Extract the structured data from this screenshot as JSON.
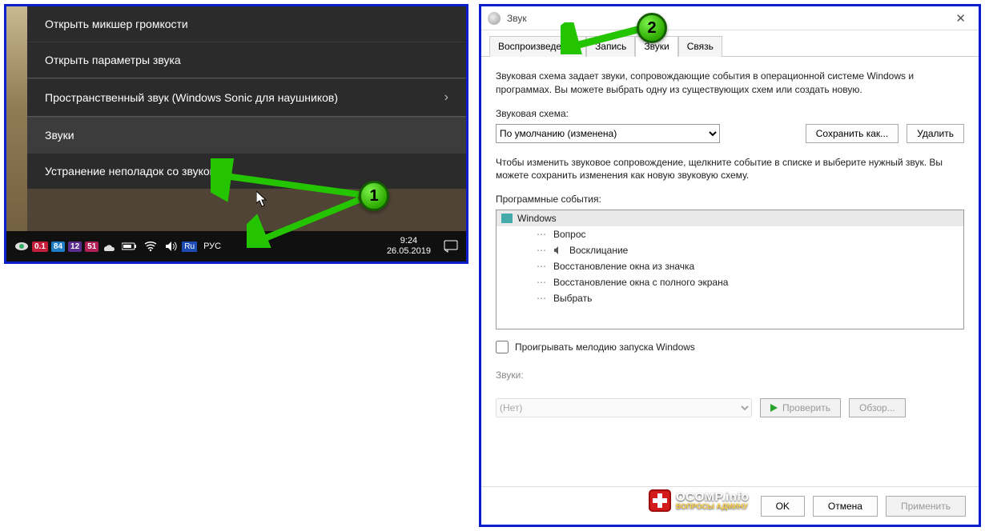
{
  "left": {
    "menu": {
      "items": [
        "Открыть микшер громкости",
        "Открыть параметры звука",
        "Пространственный звук (Windows Sonic для наушников)",
        "Звуки",
        "Устранение неполадок со звуком"
      ]
    },
    "taskbar": {
      "badges": [
        "0.1",
        "84",
        "12",
        "51"
      ],
      "lang_badge": "Ru",
      "lang": "РУС",
      "time": "9:24",
      "date": "26.05.2019"
    }
  },
  "right": {
    "title": "Звук",
    "tabs": [
      "Воспроизведение",
      "Запись",
      "Звуки",
      "Связь"
    ],
    "active_tab": 2,
    "desc": "Звуковая схема задает звуки, сопровождающие события в операционной системе Windows и программах. Вы можете выбрать одну из существующих схем или создать новую.",
    "scheme_label": "Звуковая схема:",
    "scheme_value": "По умолчанию (изменена)",
    "save_as": "Сохранить как...",
    "delete": "Удалить",
    "change_desc": "Чтобы изменить звуковое сопровождение, щелкните событие в списке и выберите нужный звук. Вы можете сохранить изменения как новую звуковую схему.",
    "events_label": "Программные события:",
    "events_root": "Windows",
    "events": [
      {
        "label": "Вопрос",
        "hasSound": false
      },
      {
        "label": "Восклицание",
        "hasSound": true
      },
      {
        "label": "Восстановление окна из значка",
        "hasSound": false
      },
      {
        "label": "Восстановление окна с полного экрана",
        "hasSound": false
      },
      {
        "label": "Выбрать",
        "hasSound": false
      }
    ],
    "play_startup": "Проигрывать мелодию запуска Windows",
    "sounds_label": "Звуки:",
    "sounds_value": "(Нет)",
    "check_btn": "Проверить",
    "browse_btn": "Обзор...",
    "footer": {
      "ok": "OK",
      "cancel": "Отмена",
      "apply": "Применить"
    }
  },
  "steps": {
    "one": "1",
    "two": "2"
  },
  "watermark": {
    "main": "OCOMP.info",
    "sub": "ВОПРОСЫ АДМИНУ"
  }
}
